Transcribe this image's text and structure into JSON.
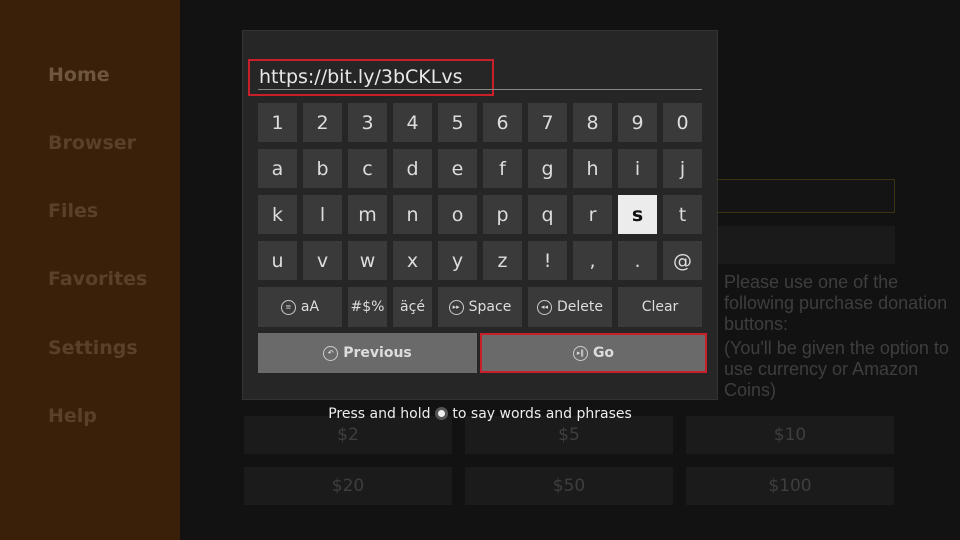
{
  "sidebar": {
    "items": [
      {
        "label": "Home"
      },
      {
        "label": "Browser"
      },
      {
        "label": "Files"
      },
      {
        "label": "Favorites"
      },
      {
        "label": "Settings"
      },
      {
        "label": "Help"
      }
    ]
  },
  "background": {
    "donation_text": "Please use one of the following purchase donation buttons:",
    "donation_note": "(You'll be given the option to use currency or Amazon Coins)",
    "amounts": [
      "$2",
      "$5",
      "$10",
      "$20",
      "$50",
      "$100"
    ]
  },
  "keyboard": {
    "url_value": "https://bit.ly/3bCKLvs",
    "rows": [
      [
        "1",
        "2",
        "3",
        "4",
        "5",
        "6",
        "7",
        "8",
        "9",
        "0"
      ],
      [
        "a",
        "b",
        "c",
        "d",
        "e",
        "f",
        "g",
        "h",
        "i",
        "j"
      ],
      [
        "k",
        "l",
        "m",
        "n",
        "o",
        "p",
        "q",
        "r",
        "s",
        "t"
      ],
      [
        "u",
        "v",
        "w",
        "x",
        "y",
        "z",
        "!",
        ",",
        ".",
        "@"
      ]
    ],
    "selected_key": "s",
    "case_label": "aA",
    "symbols_label": "#$%",
    "accents_label": "äçé",
    "space_label": "Space",
    "delete_label": "Delete",
    "clear_label": "Clear",
    "previous_label": "Previous",
    "go_label": "Go",
    "hint_before": "Press and hold",
    "hint_after": "to say words and phrases",
    "accent_color": "#c8202a"
  }
}
